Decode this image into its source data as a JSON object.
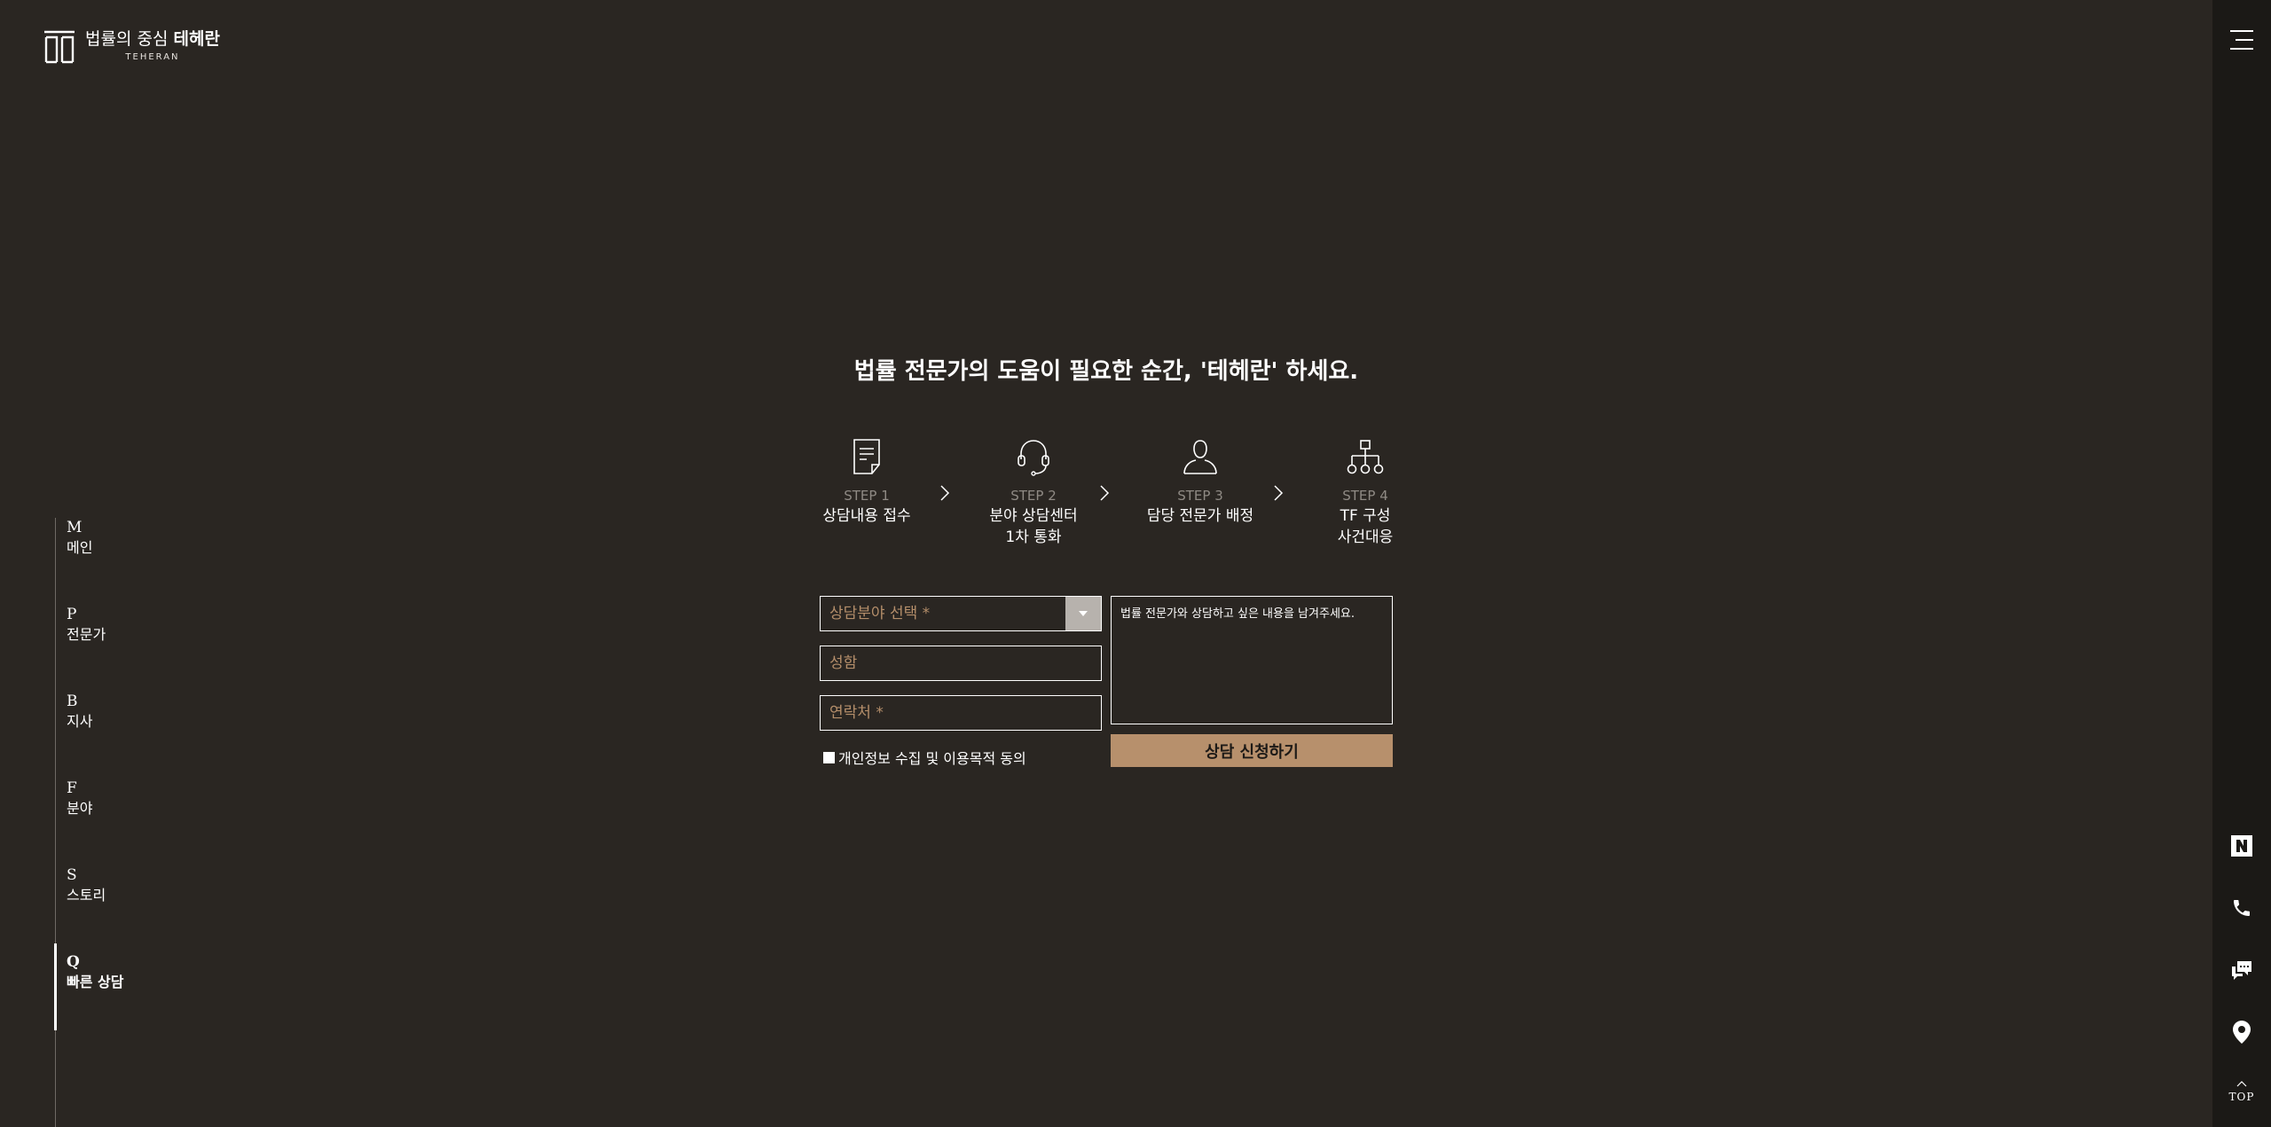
{
  "brand": {
    "name_light": "법률의 중심",
    "name_bold": "테헤란",
    "name_en": "TEHERAN"
  },
  "headline": "법률 전문가의 도움이 필요한 순간, '테헤란' 하세요.",
  "steps": [
    {
      "no": "STEP 1",
      "title": "상담내용 접수",
      "icon": "document-icon"
    },
    {
      "no": "STEP 2",
      "title": "분야 상담센터\n1차 통화",
      "icon": "headset-icon"
    },
    {
      "no": "STEP 3",
      "title": "담당 전문가 배정",
      "icon": "person-icon"
    },
    {
      "no": "STEP 4",
      "title": "TF 구성\n사건대응",
      "icon": "org-chart-icon"
    }
  ],
  "form": {
    "category_placeholder": "상담분야 선택 *",
    "name_placeholder": "성함",
    "contact_placeholder": "연락처 *",
    "message_placeholder": "법률 전문가와 상담하고 싶은 내용을 남겨주세요.",
    "agree_label": "개인정보 수집 및 이용목적 동의",
    "submit_label": "상담 신청하기"
  },
  "left_nav": [
    {
      "letter": "M",
      "label": "메인",
      "active": false
    },
    {
      "letter": "P",
      "label": "전문가",
      "active": false
    },
    {
      "letter": "B",
      "label": "지사",
      "active": false
    },
    {
      "letter": "F",
      "label": "분야",
      "active": false
    },
    {
      "letter": "S",
      "label": "스토리",
      "active": false
    },
    {
      "letter": "Q",
      "label": "빠른 상담",
      "active": true
    }
  ],
  "right_rail": {
    "icons": [
      "hamburger-menu-icon",
      "naver-icon",
      "phone-icon",
      "chat-icon",
      "location-pin-icon"
    ],
    "top_label": "TOP"
  },
  "colors": {
    "background": "#2a2622",
    "rail": "#1b1916",
    "accent": "#b7906c",
    "placeholder": "#b48e6a"
  }
}
